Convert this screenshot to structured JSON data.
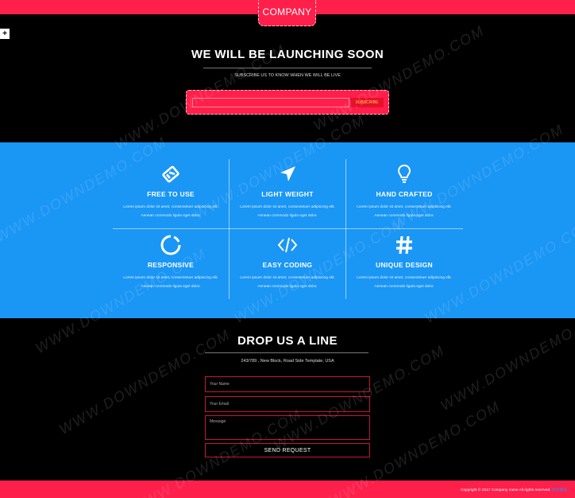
{
  "header": {
    "logo": "COMPANY",
    "plus_label": "+"
  },
  "hero": {
    "title": "WE WILL BE LAUNCHING SOON",
    "subtitle": "SUBSCRIBE US TO KNOW WHEN WE WILL BE LIVE",
    "subscribe_placeholder": "",
    "subscribe_label": "SUBSCRIBE"
  },
  "features": [
    {
      "icon": "ticket-icon",
      "title": "FREE TO USE",
      "desc": "Lorem ipsum dolor sit amet, consectetuer adipiscing elit. Aenean commodo ligula eget dolor."
    },
    {
      "icon": "navigation-arrow-icon",
      "title": "LIGHT WEIGHT",
      "desc": "Lorem ipsum dolor sit amet, consectetuer adipiscing elit. Aenean commodo ligula eget dolor."
    },
    {
      "icon": "lightbulb-icon",
      "title": "HAND CRAFTED",
      "desc": "Lorem ipsum dolor sit amet, consectetuer adipiscing elit. Aenean commodo ligula eget dolor."
    },
    {
      "icon": "circle-loader-icon",
      "title": "RESPONSIVE",
      "desc": "Lorem ipsum dolor sit amet, consectetuer adipiscing elit. Aenean commodo ligula eget dolor."
    },
    {
      "icon": "code-brackets-icon",
      "title": "EASY CODING",
      "desc": "Lorem ipsum dolor sit amet, consectetuer adipiscing elit. Aenean commodo ligula eget dolor."
    },
    {
      "icon": "hashtag-icon",
      "title": "UNIQUE DESIGN",
      "desc": "Lorem ipsum dolor sit amet, consectetuer adipiscing elit. Aenean commodo ligula eget dolor."
    }
  ],
  "contact": {
    "title": "DROP US A LINE",
    "address": "243/789 , New Block, Road Side Template, USA",
    "name_placeholder": "Your Name",
    "email_placeholder": "Your Email",
    "message_placeholder": "Message",
    "send_label": "SEND REQUEST"
  },
  "footer": {
    "copyright": "Copyright © 2017 Company name All rights reserved.",
    "link_text": "网页模板"
  },
  "watermark": "WWW.DOWNDEMO.COM",
  "colors": {
    "accent": "#ff1f4b",
    "features_bg": "#1a96f5",
    "page_bg": "#000000"
  }
}
